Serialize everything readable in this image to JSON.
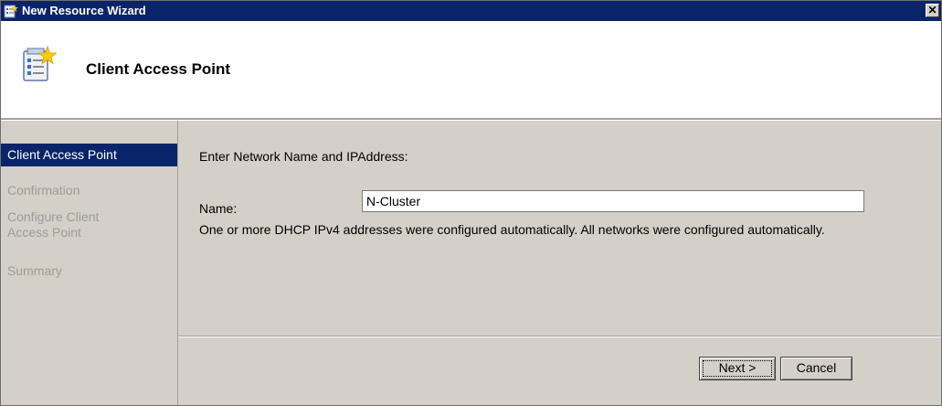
{
  "window": {
    "title": "New Resource Wizard",
    "close_glyph": "✕"
  },
  "header": {
    "title": "Client Access Point",
    "icon": "wizard-checklist-icon"
  },
  "nav": {
    "items": [
      {
        "label": "Client Access Point",
        "active": true
      },
      {
        "label": "Confirmation",
        "active": false
      },
      {
        "label": "Configure Client\nAccess Point",
        "active": false
      },
      {
        "label": "Summary",
        "active": false
      }
    ]
  },
  "content": {
    "prompt": "Enter Network Name and IPAddress:",
    "name_label": "Name:",
    "name_value": "N-Cluster",
    "note": "One or more DHCP IPv4 addresses were configured automatically.  All networks were configured automatically."
  },
  "buttons": {
    "next": "Next >",
    "cancel": "Cancel"
  },
  "colors": {
    "titlebar": "#0a246a",
    "active_nav": "#0a246a",
    "dialog_bg": "#d4d0c8",
    "disabled_text": "#9b9b9b"
  }
}
